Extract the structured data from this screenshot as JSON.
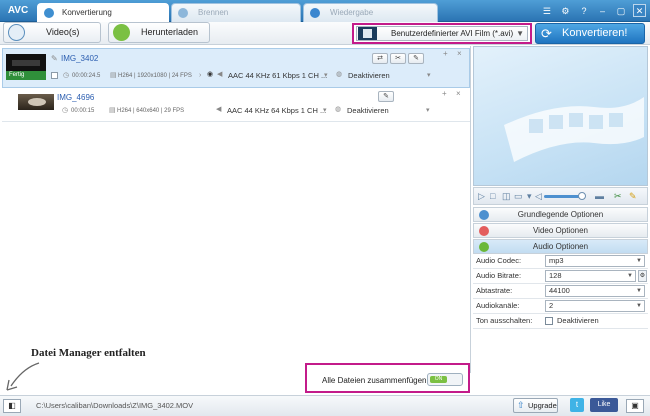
{
  "app": {
    "logo": "AVC"
  },
  "tabs": [
    {
      "label": "Konvertierung",
      "active": true
    },
    {
      "label": "Brennen",
      "active": false
    },
    {
      "label": "Wiedergabe",
      "active": false
    }
  ],
  "window_controls": {
    "menu": "☰",
    "settings": "⚙",
    "help": "?",
    "minimize": "–",
    "maximize": "▢",
    "close": "✕"
  },
  "toolbar": {
    "add_video_label": "Video(s)",
    "download_label": "Herunterladen",
    "format_value": "Benutzerdefinierter AVI Film (*.avi)",
    "convert_label": "Konvertieren!"
  },
  "files": [
    {
      "name": "IMG_3402",
      "status": "Fertig",
      "duration": "00:00:24.5",
      "video_info": "H264 | 1920x1080 | 24 FPS",
      "audio": "AAC 44 KHz 61 Kbps 1 CH ...",
      "subtitle": "Deaktivieren",
      "selected": true
    },
    {
      "name": "IMG_4696",
      "status": "",
      "duration": "00:00:15",
      "video_info": "H264 | 640x640 | 29 FPS",
      "audio": "AAC 44 KHz 64 Kbps 1 CH ...",
      "subtitle": "Deaktivieren",
      "selected": false
    }
  ],
  "options": {
    "basic_label": "Grundlegende Optionen",
    "video_label": "Video Optionen",
    "audio_label": "Audio Optionen",
    "rows": [
      {
        "label": "Audio Codec:",
        "value": "mp3"
      },
      {
        "label": "Audio Bitrate:",
        "value": "128"
      },
      {
        "label": "Abtastrate:",
        "value": "44100"
      },
      {
        "label": "Audiokanäle:",
        "value": "2"
      },
      {
        "label": "Ton ausschalten:",
        "value": "Deaktivieren"
      }
    ]
  },
  "bottom": {
    "file_manager_hint": "Datei Manager entfalten",
    "merge_label": "Alle Dateien zusammenfügen",
    "toggle_state": "ON"
  },
  "statusbar": {
    "path": "C:\\Users\\caliban\\Downloads\\Z\\IMG_3402.MOV",
    "upgrade_label": "Upgrade",
    "facebook_label": "Like"
  },
  "colors": {
    "accent": "#2b74b3",
    "highlight_frame": "#c31b8a",
    "done_badge": "#2f8f3a"
  }
}
